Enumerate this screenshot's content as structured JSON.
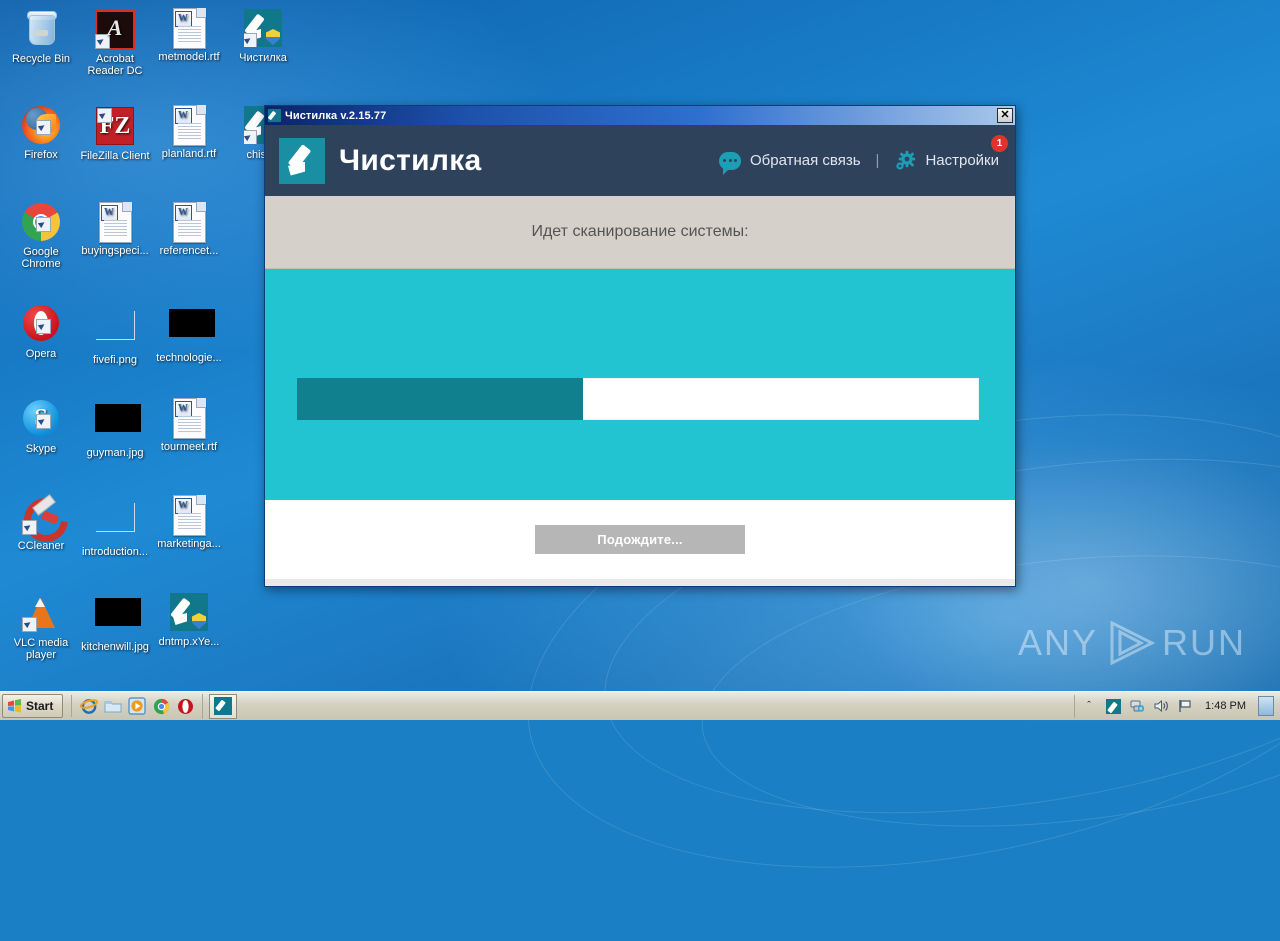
{
  "desktop": {
    "icons": [
      {
        "label": "Recycle Bin",
        "kind": "recycle-bin"
      },
      {
        "label": "Acrobat Reader DC",
        "kind": "acrobat"
      },
      {
        "label": "metmodel.rtf",
        "kind": "word-doc"
      },
      {
        "label": "Чистилка",
        "kind": "chistilka"
      },
      {
        "label": "Firefox",
        "kind": "firefox"
      },
      {
        "label": "FileZilla Client",
        "kind": "filezilla"
      },
      {
        "label": "planland.rtf",
        "kind": "word-doc"
      },
      {
        "label": "chistilk",
        "kind": "chistilka"
      },
      {
        "label": "Google Chrome",
        "kind": "chrome"
      },
      {
        "label": "buyingspeci...",
        "kind": "word-doc"
      },
      {
        "label": "referencet...",
        "kind": "word-doc"
      },
      {
        "label": "Opera",
        "kind": "opera"
      },
      {
        "label": "fivefi.png",
        "kind": "image-frame"
      },
      {
        "label": "technologie...",
        "kind": "image-black"
      },
      {
        "label": "Skype",
        "kind": "skype"
      },
      {
        "label": "guyman.jpg",
        "kind": "image-black"
      },
      {
        "label": "tourmeet.rtf",
        "kind": "word-doc"
      },
      {
        "label": "CCleaner",
        "kind": "ccleaner"
      },
      {
        "label": "introduction...",
        "kind": "image-frame"
      },
      {
        "label": "marketinga...",
        "kind": "word-doc"
      },
      {
        "label": "VLC media player",
        "kind": "vlc"
      },
      {
        "label": "kitchenwill.jpg",
        "kind": "image-black"
      },
      {
        "label": "dntmp.xYe...",
        "kind": "chistilka"
      }
    ],
    "watermark": {
      "left_text": "ANY",
      "right_text": "RUN",
      "logo": "play-triangle-icon"
    }
  },
  "window": {
    "titlebar": {
      "title": "Чистилка v.2.15.77",
      "icon": "brush-icon",
      "close_label": "✕"
    },
    "header": {
      "logo_icon": "brush-logo-icon",
      "app_name": "Чистилка",
      "feedback_label": "Обратная связь",
      "feedback_icon": "speech-bubble-icon",
      "separator": "|",
      "settings_label": "Настройки",
      "settings_icon": "gear-icon",
      "badge_count": "1",
      "badge_color": "#e0332c",
      "background_color": "#2e425c"
    },
    "status": {
      "text": "Идет сканирование системы:",
      "background_color": "#d6d0ca"
    },
    "scan": {
      "background_color": "#22c4d1",
      "progress_percent": 42,
      "progress_fill_color": "#10808f",
      "progress_track_color": "#ffffff"
    },
    "footer": {
      "button_label": "Подождите...",
      "button_color": "#b6b6b6"
    }
  },
  "taskbar": {
    "start_label": "Start",
    "quick_launch": [
      {
        "name": "internet-explorer-icon"
      },
      {
        "name": "windows-explorer-icon"
      },
      {
        "name": "media-player-icon"
      },
      {
        "name": "chrome-icon"
      },
      {
        "name": "opera-icon"
      }
    ],
    "tasks": [
      {
        "name": "chistilka-task",
        "icon": "brush-icon"
      }
    ],
    "tray": {
      "overflow_label": "ˆ",
      "icons": [
        "chistilka-tray-icon",
        "network-icon",
        "volume-icon",
        "flag-icon"
      ],
      "clock": "1:48 PM"
    }
  }
}
